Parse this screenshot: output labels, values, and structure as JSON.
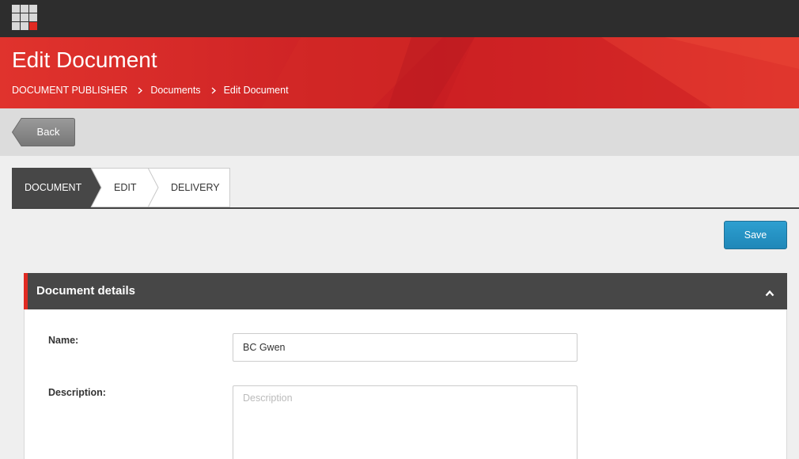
{
  "header": {
    "app_menu_icon": "app-grid-icon"
  },
  "hero": {
    "title": "Edit Document",
    "breadcrumb": [
      "DOCUMENT PUBLISHER",
      "Documents",
      "Edit Document"
    ]
  },
  "toolbar": {
    "back_label": "Back",
    "save_label": "Save"
  },
  "steps": [
    {
      "label": "DOCUMENT",
      "active": true
    },
    {
      "label": "EDIT",
      "active": false
    },
    {
      "label": "DELIVERY",
      "active": false
    }
  ],
  "panel": {
    "title": "Document details",
    "collapse_icon": "chevron-up-icon",
    "fields": {
      "name_label": "Name:",
      "name_value": "BC Gwen",
      "description_label": "Description:",
      "description_placeholder": "Description"
    }
  },
  "colors": {
    "brand_red": "#e02a22",
    "topbar": "#2d2d2d",
    "save_blue": "#2190c4",
    "active_step": "#474747"
  }
}
